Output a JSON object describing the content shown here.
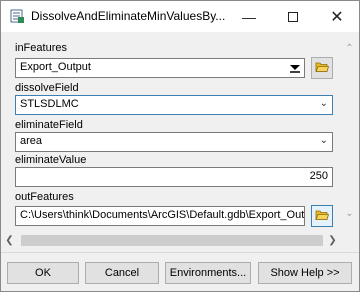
{
  "window": {
    "title": "DissolveAndEliminateMinValuesBy..."
  },
  "params": {
    "in_features": {
      "label": "inFeatures",
      "value": "Export_Output"
    },
    "dissolve_field": {
      "label": "dissolveField",
      "value": "STLSDLMC"
    },
    "eliminate_field": {
      "label": "eliminateField",
      "value": "area"
    },
    "eliminate_value": {
      "label": "eliminateValue",
      "value": "250"
    },
    "out_features": {
      "label": "outFeatures",
      "value": "C:\\Users\\think\\Documents\\ArcGIS\\Default.gdb\\Export_Outp"
    }
  },
  "buttons": {
    "ok": "OK",
    "cancel": "Cancel",
    "environments": "Environments...",
    "show_help": "Show Help >>"
  },
  "icons": {
    "app": "toolbox-script-icon",
    "folder": "open-folder-icon"
  },
  "colors": {
    "accent": "#3c7fb1",
    "folder": "#e8b923"
  }
}
